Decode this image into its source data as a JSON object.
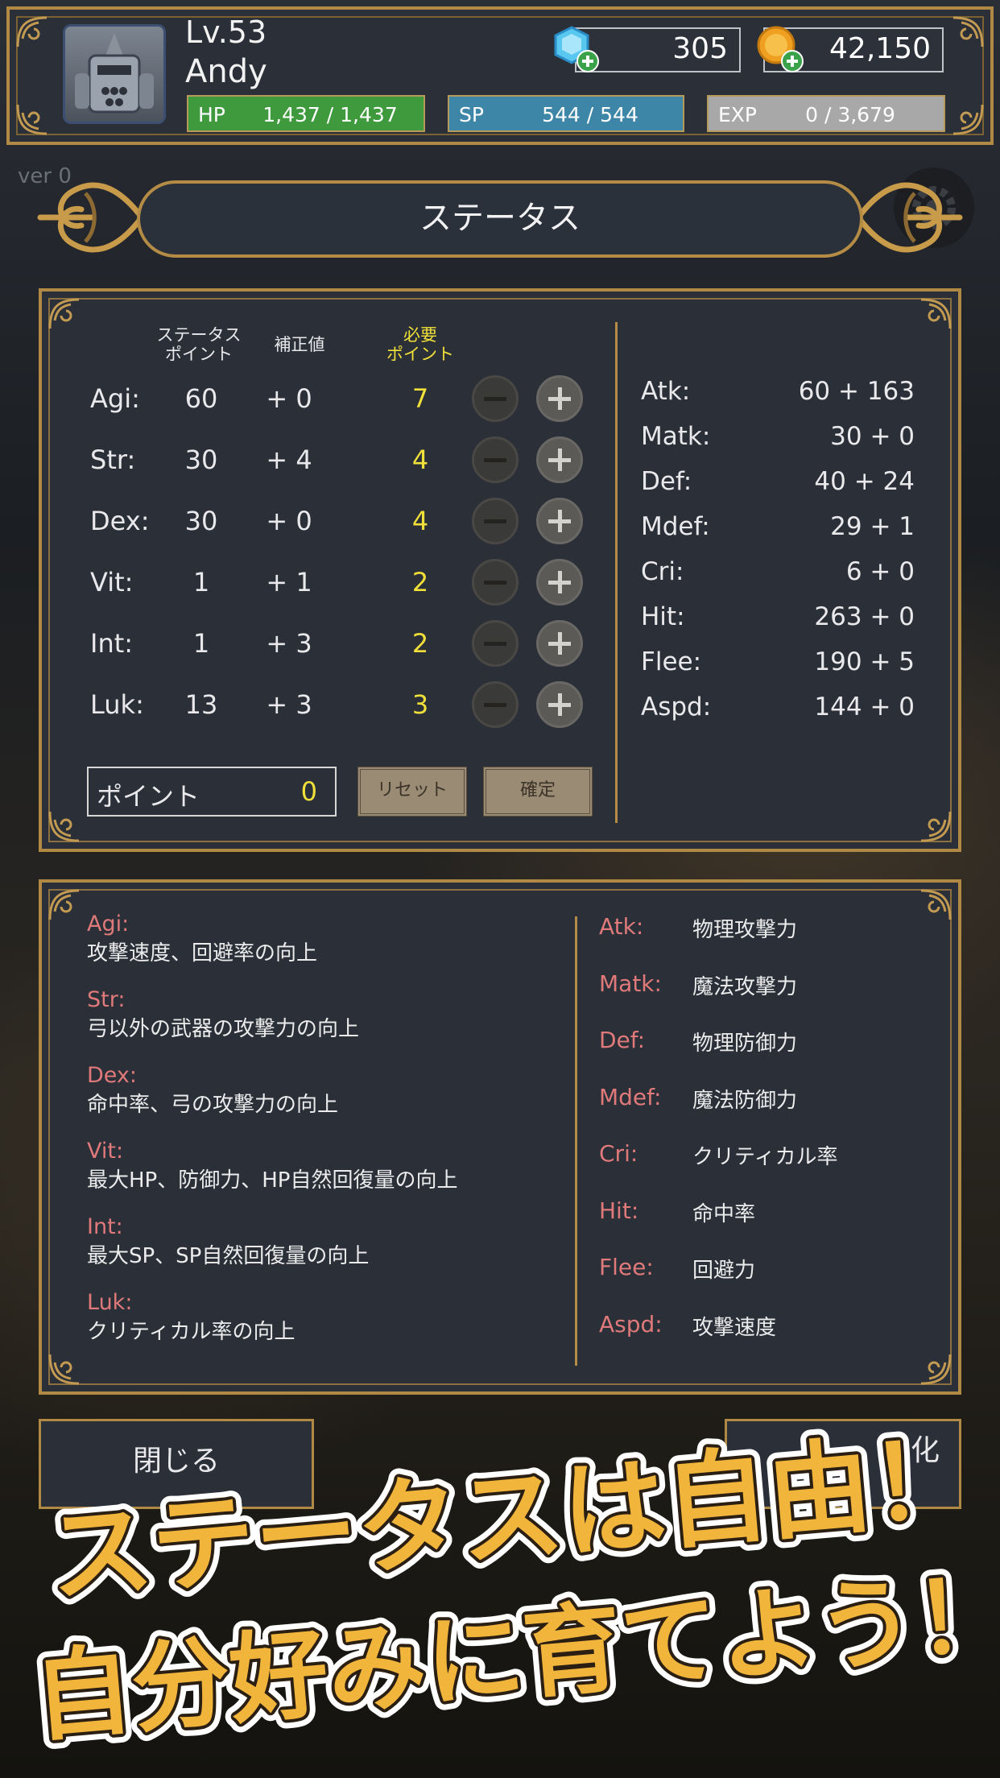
{
  "header": {
    "level": "Lv.53",
    "player_name": "Andy",
    "hp": {
      "label": "HP",
      "value": "1,437 / 1,437"
    },
    "sp": {
      "label": "SP",
      "value": "544 / 544"
    },
    "exp": {
      "label": "EXP",
      "value": "0 / 3,679"
    },
    "gems": "305",
    "coins": "42,150"
  },
  "version_text": "ver 0",
  "title": "ステータス",
  "columns": {
    "status_points_1": "ステータス",
    "status_points_2": "ポイント",
    "bonus": "補正値",
    "required_1": "必要",
    "required_2": "ポイント"
  },
  "stats": [
    {
      "name": "Agi:",
      "points": "60",
      "bonus": "+ 0",
      "required": "7"
    },
    {
      "name": "Str:",
      "points": "30",
      "bonus": "+ 4",
      "required": "4"
    },
    {
      "name": "Dex:",
      "points": "30",
      "bonus": "+ 0",
      "required": "4"
    },
    {
      "name": "Vit:",
      "points": "1",
      "bonus": "+ 1",
      "required": "2"
    },
    {
      "name": "Int:",
      "points": "1",
      "bonus": "+ 3",
      "required": "2"
    },
    {
      "name": "Luk:",
      "points": "13",
      "bonus": "+ 3",
      "required": "3"
    }
  ],
  "derived": [
    {
      "name": "Atk:",
      "value": "60 + 163"
    },
    {
      "name": "Matk:",
      "value": "30 + 0"
    },
    {
      "name": "Def:",
      "value": "40 + 24"
    },
    {
      "name": "Mdef:",
      "value": "29 + 1"
    },
    {
      "name": "Cri:",
      "value": "6 + 0"
    },
    {
      "name": "Hit:",
      "value": "263 + 0"
    },
    {
      "name": "Flee:",
      "value": "190 + 5"
    },
    {
      "name": "Aspd:",
      "value": "144 + 0"
    }
  ],
  "points": {
    "label": "ポイント",
    "value": "0"
  },
  "buttons": {
    "reset": "リセット",
    "confirm": "確定",
    "close": "閉じる",
    "strengthen": "化"
  },
  "help_stats": [
    {
      "key": "Agi:",
      "desc": "攻撃速度、回避率の向上"
    },
    {
      "key": "Str:",
      "desc": "弓以外の武器の攻撃力の向上"
    },
    {
      "key": "Dex:",
      "desc": "命中率、弓の攻撃力の向上"
    },
    {
      "key": "Vit:",
      "desc": "最大HP、防御力、HP自然回復量の向上"
    },
    {
      "key": "Int:",
      "desc": "最大SP、SP自然回復量の向上"
    },
    {
      "key": "Luk:",
      "desc": "クリティカル率の向上"
    }
  ],
  "help_derived": [
    {
      "key": "Atk:",
      "desc": "物理攻撃力"
    },
    {
      "key": "Matk:",
      "desc": "魔法攻撃力"
    },
    {
      "key": "Def:",
      "desc": "物理防御力"
    },
    {
      "key": "Mdef:",
      "desc": "魔法防御力"
    },
    {
      "key": "Cri:",
      "desc": "クリティカル率"
    },
    {
      "key": "Hit:",
      "desc": "命中率"
    },
    {
      "key": "Flee:",
      "desc": "回避力"
    },
    {
      "key": "Aspd:",
      "desc": "攻撃速度"
    }
  ],
  "promo": {
    "line1": "ステータスは自由！",
    "line2": "自分好みに育てよう！"
  },
  "colors": {
    "gold": "#b08a44",
    "yellow": "#f1e03a",
    "hp": "#3f9a3d",
    "sp": "#3e86a8",
    "exp": "#a8a8a8",
    "help_key": "#e07a7a",
    "promo_fill": "#f2b53c"
  }
}
